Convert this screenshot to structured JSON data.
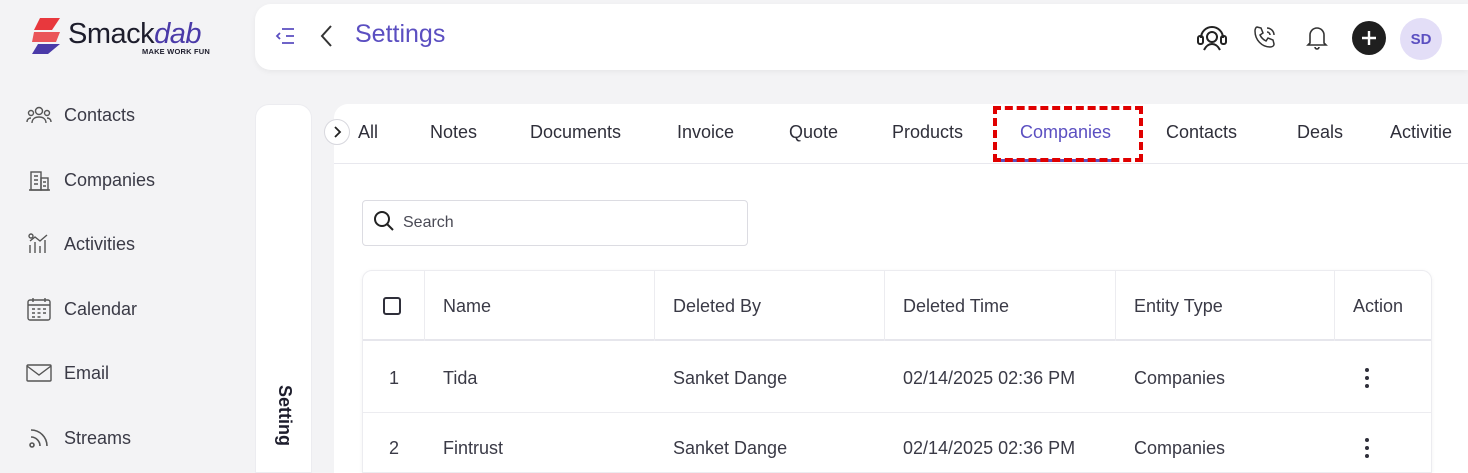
{
  "brand": {
    "name_a": "Smack",
    "name_b": "dab",
    "tagline": "MAKE WORK FUN"
  },
  "nav": {
    "items": [
      {
        "label": "Contacts",
        "icon": "contacts-icon"
      },
      {
        "label": "Companies",
        "icon": "companies-icon"
      },
      {
        "label": "Activities",
        "icon": "activities-icon"
      },
      {
        "label": "Calendar",
        "icon": "calendar-icon"
      },
      {
        "label": "Email",
        "icon": "email-icon"
      },
      {
        "label": "Streams",
        "icon": "streams-icon"
      }
    ]
  },
  "header": {
    "title": "Settings",
    "avatar_initials": "SD",
    "icons": [
      "sidebar-toggle-icon",
      "back-icon",
      "support-icon",
      "phone-icon",
      "bell-icon",
      "plus-icon"
    ]
  },
  "settings_strip": {
    "label": "Setting"
  },
  "tabs": [
    {
      "label": "All"
    },
    {
      "label": "Notes"
    },
    {
      "label": "Documents"
    },
    {
      "label": "Invoice"
    },
    {
      "label": "Quote"
    },
    {
      "label": "Products"
    },
    {
      "label": "Companies",
      "active": true
    },
    {
      "label": "Contacts"
    },
    {
      "label": "Deals"
    },
    {
      "label": "Activitie"
    }
  ],
  "search": {
    "placeholder": "Search",
    "value": ""
  },
  "table": {
    "columns": [
      "",
      "Name",
      "Deleted By",
      "Deleted Time",
      "Entity Type",
      "Action"
    ],
    "rows": [
      {
        "index": "1",
        "name": "Tida",
        "deleted_by": "Sanket Dange",
        "deleted_time": "02/14/2025 02:36 PM",
        "entity_type": "Companies"
      },
      {
        "index": "2",
        "name": "Fintrust",
        "deleted_by": "Sanket Dange",
        "deleted_time": "02/14/2025 02:36 PM",
        "entity_type": "Companies"
      }
    ]
  },
  "colors": {
    "accent": "#5b4fc1",
    "highlight": "#e00000",
    "logo_red": "#e8383d",
    "logo_purple": "#4a3aa8"
  }
}
